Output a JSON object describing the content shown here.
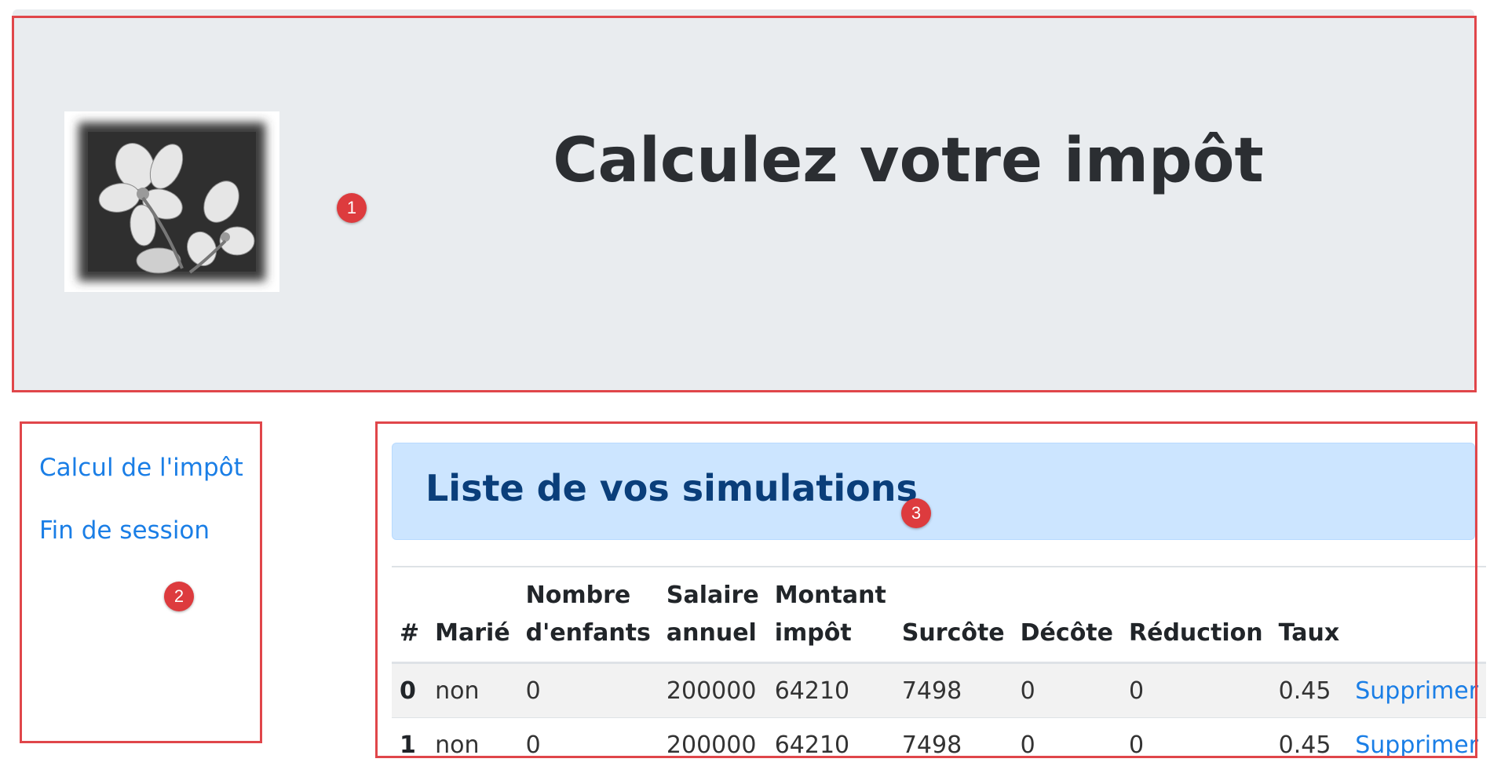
{
  "header": {
    "title": "Calculez votre impôt",
    "logo_icon": "flower-photo-icon",
    "bg_color": "#e9ecef"
  },
  "sidebar": {
    "items": [
      {
        "label": "Calcul de l'impôt"
      },
      {
        "label": "Fin de session"
      }
    ],
    "link_color": "#1a7ee6"
  },
  "main": {
    "alert_title": "Liste de vos simulations",
    "table": {
      "headers": [
        "#",
        "Marié",
        "Nombre d'enfants",
        "Salaire annuel",
        "Montant impôt",
        "Surcôte",
        "Décôte",
        "Réduction",
        "Taux",
        ""
      ],
      "rows": [
        [
          "0",
          "non",
          "0",
          "200000",
          "64210",
          "7498",
          "0",
          "0",
          "0.45",
          "Supprimer"
        ],
        [
          "1",
          "non",
          "0",
          "200000",
          "64210",
          "7498",
          "0",
          "0",
          "0.45",
          "Supprimer"
        ]
      ]
    }
  },
  "annotations": {
    "badges": [
      "1",
      "2",
      "3"
    ],
    "color": "#e0464a"
  }
}
